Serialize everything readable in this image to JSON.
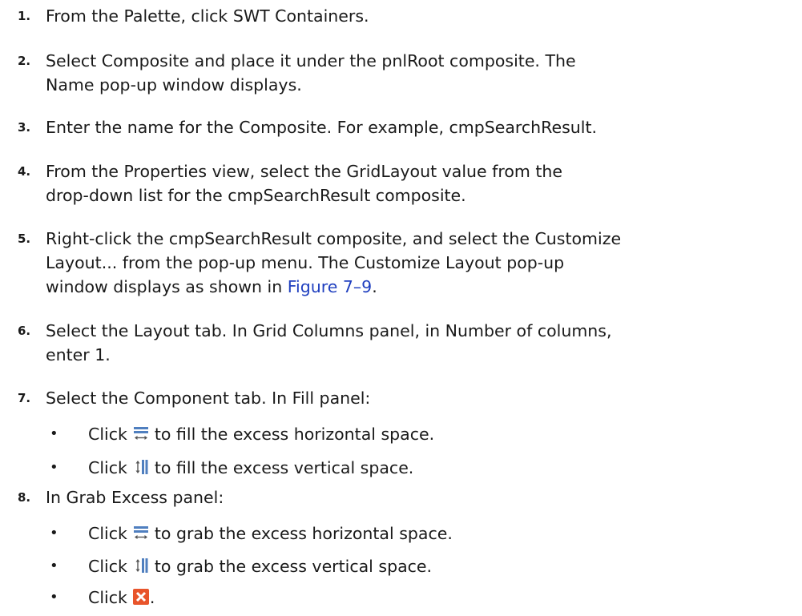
{
  "steps": [
    {
      "num": "1.",
      "lines": [
        "From the Palette, click SWT Containers."
      ]
    },
    {
      "num": "2.",
      "lines": [
        "Select Composite and place it under the pnlRoot composite. The",
        "Name pop-up window displays."
      ]
    },
    {
      "num": "3.",
      "lines": [
        "Enter the name for the Composite. For example, cmpSearchResult."
      ]
    },
    {
      "num": "4.",
      "lines": [
        "From the Properties view, select the GridLayout value from the",
        "drop-down list for the cmpSearchResult composite."
      ]
    },
    {
      "num": "5.",
      "lines": [
        "Right-click the cmpSearchResult composite, and select the Customize",
        "Layout... from the pop-up menu. The Customize Layout pop-up"
      ],
      "line3_pre": "window displays as shown in ",
      "line3_link": "Figure 7–9",
      "line3_post": "."
    },
    {
      "num": "6.",
      "lines": [
        "Select the Layout tab. In Grid Columns panel, in Number of columns,",
        "enter 1."
      ]
    },
    {
      "num": "7.",
      "lines": [
        "Select the Component tab. In Fill panel:"
      ]
    },
    {
      "num": "8.",
      "lines": [
        "In Grab Excess panel:"
      ]
    }
  ],
  "bullets": {
    "click": "Click",
    "fill_h": "to fill the excess horizontal space.",
    "fill_v": "to fill the excess vertical space.",
    "grab_h": "to grab the excess horizontal space.",
    "grab_v": "to grab the excess vertical space.",
    "close_suffix": ".",
    "bullet_char": "•"
  },
  "icons": {
    "horizontal": "fill-horizontal-icon",
    "vertical": "fill-vertical-icon",
    "close": "close-icon"
  },
  "colors": {
    "link": "#1f3fbf",
    "close_icon": "#e8542b"
  }
}
